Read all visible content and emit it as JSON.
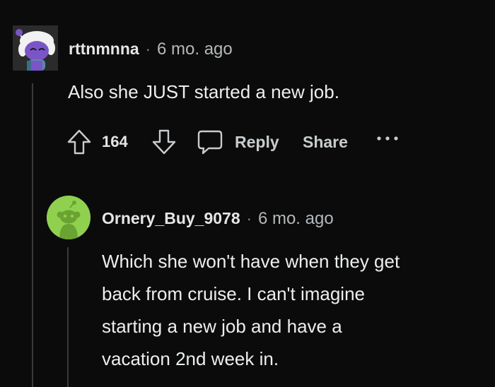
{
  "comment1": {
    "username": "rttnmnna",
    "separator": "·",
    "time": "6 mo. ago",
    "body": "Also she JUST started a new job.",
    "score": "164",
    "reply_label": "Reply",
    "share_label": "Share",
    "more_label": "···"
  },
  "comment2": {
    "username": "Ornery_Buy_9078",
    "separator": "·",
    "time": "6 mo. ago",
    "body_lines": [
      "Which she won't have when they get",
      "back from cruise. I can't imagine",
      "starting a new job and have a",
      "vacation 2nd week in."
    ]
  },
  "colors": {
    "background": "#0b0b0b",
    "thread_line": "#3a3a3a",
    "avatar1_bg": "#2b2b2b",
    "avatar1_char": "#7a55c8",
    "avatar2_bg": "#8fd14f",
    "icon": "#c8ccce"
  },
  "icons": {
    "upvote": "arrow-up-outline",
    "downvote": "arrow-down-outline",
    "comment": "speech-bubble-outline",
    "more": "ellipsis-horizontal"
  }
}
